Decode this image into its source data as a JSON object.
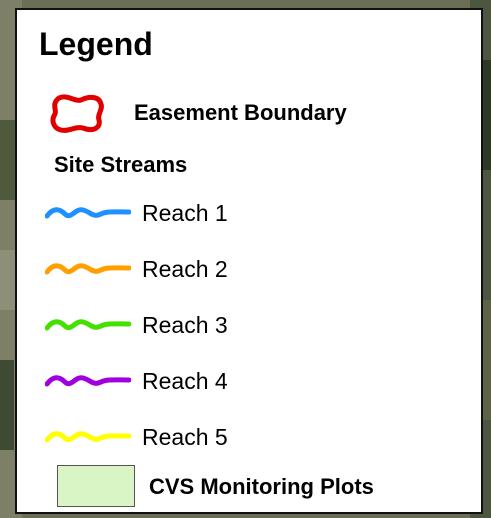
{
  "legend": {
    "title": "Legend",
    "easement": {
      "label": "Easement Boundary",
      "color": "#e00000",
      "icon": "easement-boundary-icon"
    },
    "streams_heading": "Site Streams",
    "reaches": [
      {
        "label": "Reach 1",
        "color": "#1e90ff",
        "icon": "stream-line-icon"
      },
      {
        "label": "Reach 2",
        "color": "#ffa000",
        "icon": "stream-line-icon"
      },
      {
        "label": "Reach 3",
        "color": "#44e000",
        "icon": "stream-line-icon"
      },
      {
        "label": "Reach 4",
        "color": "#a000e0",
        "icon": "stream-line-icon"
      },
      {
        "label": "Reach 5",
        "color": "#ffff00",
        "icon": "stream-line-icon"
      }
    ],
    "plots": {
      "label": "CVS Monitoring Plots",
      "fill": "#d9f5c6"
    }
  }
}
